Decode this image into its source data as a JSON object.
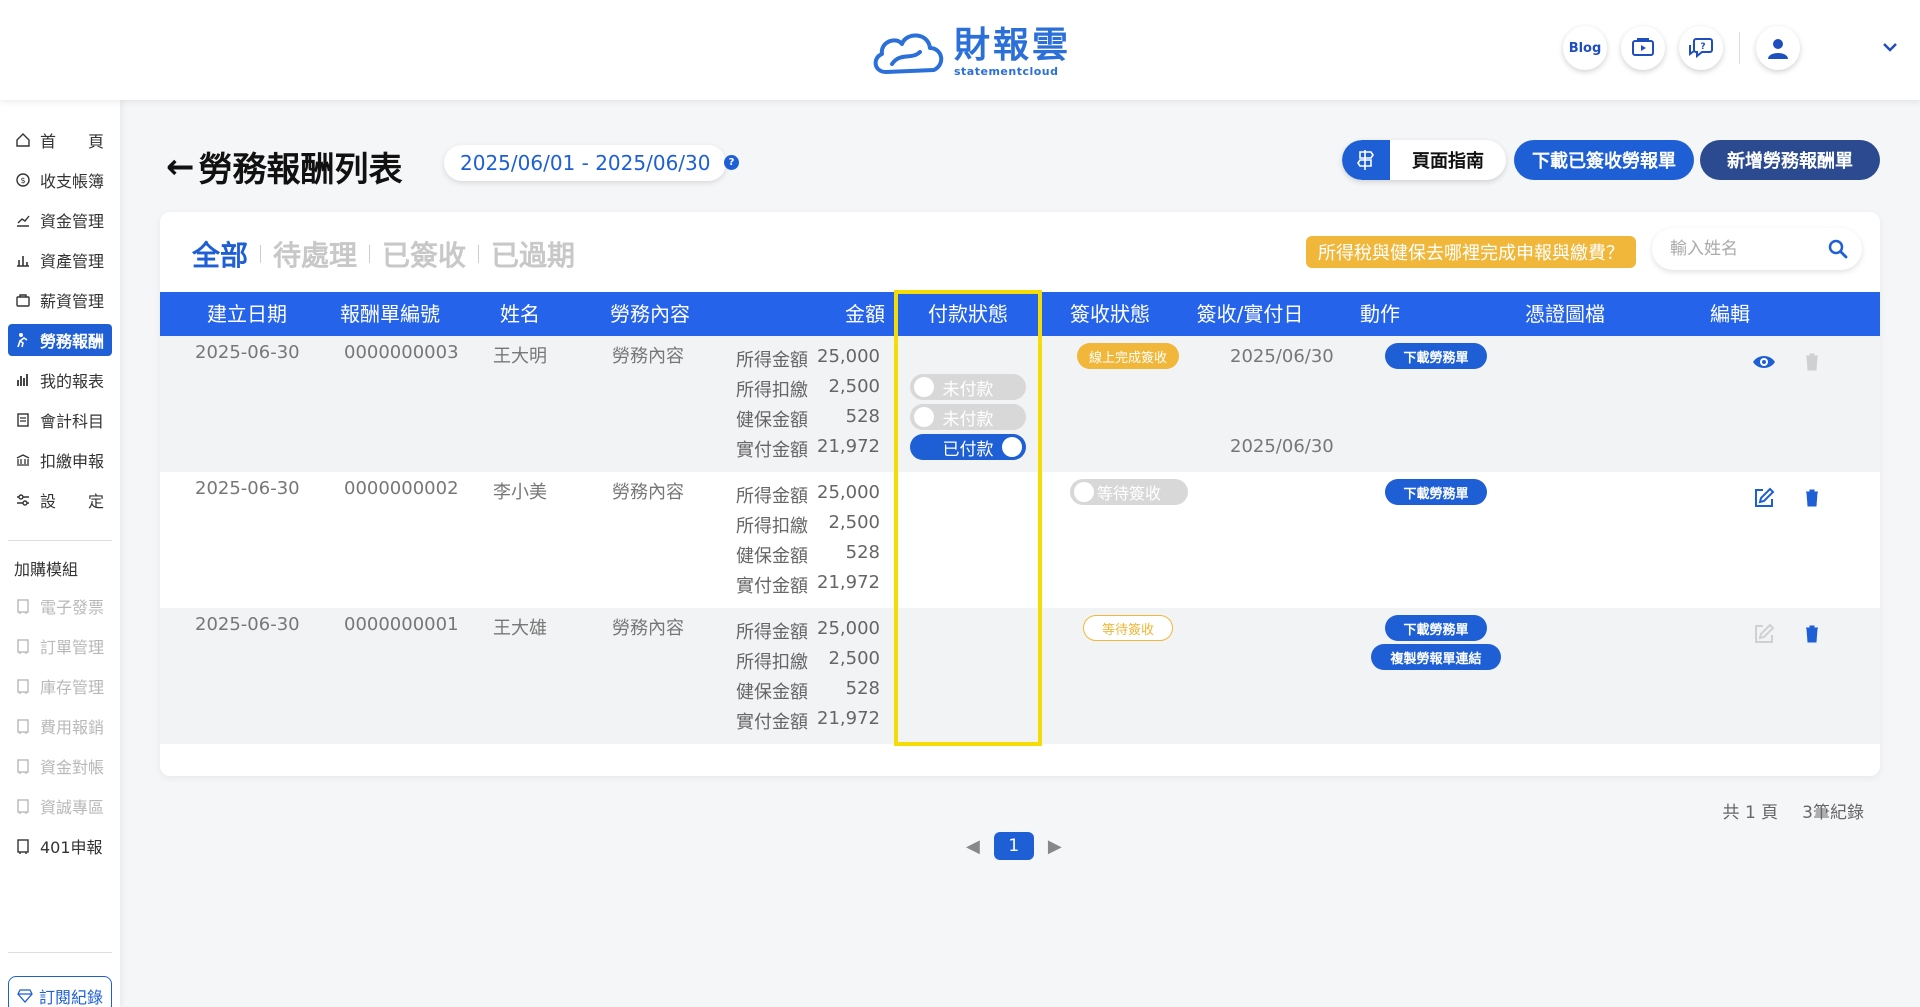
{
  "header": {
    "logo_text": "財報雲",
    "logo_sub": "statementcloud",
    "blog_label": "Blog"
  },
  "sidebar": {
    "items": [
      {
        "label": "首　　頁",
        "icon": "home-icon"
      },
      {
        "label": "收支帳簿",
        "icon": "coin-icon"
      },
      {
        "label": "資金管理",
        "icon": "fund-icon"
      },
      {
        "label": "資產管理",
        "icon": "asset-icon"
      },
      {
        "label": "薪資管理",
        "icon": "salary-icon"
      },
      {
        "label": "勞務報酬",
        "icon": "service-fee-icon"
      },
      {
        "label": "我的報表",
        "icon": "report-icon"
      },
      {
        "label": "會計科目",
        "icon": "ledger-icon"
      },
      {
        "label": "扣繳申報",
        "icon": "withholding-icon"
      },
      {
        "label": "設　　定",
        "icon": "settings-icon"
      }
    ],
    "addon_heading": "加購模組",
    "addons": [
      {
        "label": "電子發票",
        "enabled": false
      },
      {
        "label": "訂單管理",
        "enabled": false
      },
      {
        "label": "庫存管理",
        "enabled": false
      },
      {
        "label": "費用報銷",
        "enabled": false
      },
      {
        "label": "資金對帳",
        "enabled": false
      },
      {
        "label": "資誠專區",
        "enabled": false
      },
      {
        "label": "401申報",
        "enabled": true
      }
    ],
    "subscription_label": "訂閱紀錄"
  },
  "page": {
    "back_arrow": "←",
    "title": "勞務報酬列表",
    "date_range": "2025/06/01 - 2025/06/30",
    "help_mark": "?",
    "guide_label": "頁面指南",
    "download_signed_label": "下載已簽收勞報單",
    "new_label": "新增勞務報酬單"
  },
  "tabs": [
    "全部",
    "待處理",
    "已簽收",
    "已過期"
  ],
  "active_tab": 0,
  "tax_link": "所得稅與健保去哪裡完成申報與繳費？",
  "search": {
    "placeholder": "輸入姓名",
    "value": ""
  },
  "table": {
    "columns": [
      "建立日期",
      "報酬單編號",
      "姓名",
      "勞務內容",
      "金額",
      "付款狀態",
      "簽收狀態",
      "簽收/實付日",
      "動作",
      "憑證圖檔",
      "編輯"
    ],
    "amount_labels": [
      "所得金額",
      "所得扣繳",
      "健保金額",
      "實付金額"
    ],
    "rows": [
      {
        "date": "2025-06-30",
        "number": "0000000003",
        "name": "王大明",
        "content": "勞務內容",
        "amounts": [
          "25,000",
          "2,500",
          "528",
          "21,972"
        ],
        "pay_toggles": [
          {
            "label": "未付款",
            "on": false
          },
          {
            "label": "未付款",
            "on": false
          },
          {
            "label": "已付款",
            "on": true
          }
        ],
        "sign_status": "線上完成簽收",
        "sign_date": "2025/06/30",
        "paid_date": "2025/06/30",
        "actions": [
          "下載勞務單"
        ]
      },
      {
        "date": "2025-06-30",
        "number": "0000000002",
        "name": "李小美",
        "content": "勞務內容",
        "amounts": [
          "25,000",
          "2,500",
          "528",
          "21,972"
        ],
        "sign_status": "等待簽收",
        "actions": [
          "下載勞務單"
        ]
      },
      {
        "date": "2025-06-30",
        "number": "0000000001",
        "name": "王大雄",
        "content": "勞務內容",
        "amounts": [
          "25,000",
          "2,500",
          "528",
          "21,972"
        ],
        "sign_status": "等待簽收",
        "actions": [
          "下載勞務單",
          "複製勞報單連結"
        ]
      }
    ]
  },
  "footer": {
    "pages_text": "共 1 頁",
    "records_text": "3筆紀錄",
    "current_page": "1"
  },
  "colors": {
    "primary": "#1f5fd6",
    "header_bg": "#2563eb",
    "dark_button": "#2b4a8f",
    "warning": "#f0b73a",
    "highlight": "#f5dc05"
  }
}
